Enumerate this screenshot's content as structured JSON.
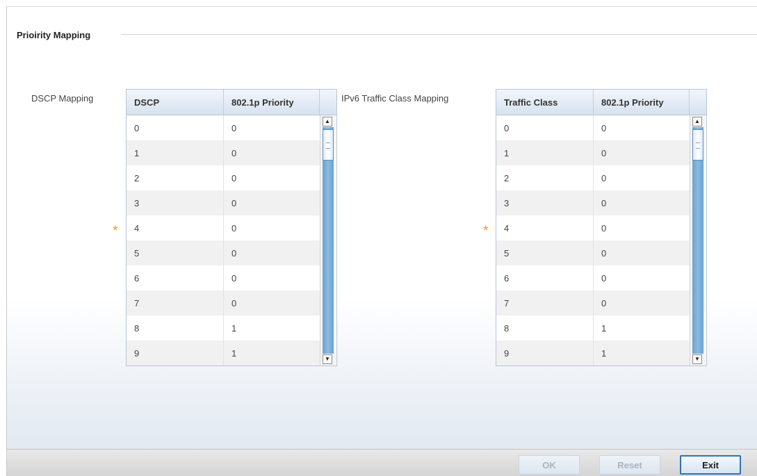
{
  "section": {
    "title": "Prioirity Mapping"
  },
  "dscp": {
    "label": "DSCP Mapping",
    "columns": [
      "DSCP",
      "802.1p Priority"
    ],
    "rows": [
      [
        "0",
        "0"
      ],
      [
        "1",
        "0"
      ],
      [
        "2",
        "0"
      ],
      [
        "3",
        "0"
      ],
      [
        "4",
        "0"
      ],
      [
        "5",
        "0"
      ],
      [
        "6",
        "0"
      ],
      [
        "7",
        "0"
      ],
      [
        "8",
        "1"
      ],
      [
        "9",
        "1"
      ]
    ]
  },
  "ipv6": {
    "label": "IPv6 Traffic Class Mapping",
    "columns": [
      "Traffic Class",
      "802.1p Priority"
    ],
    "rows": [
      [
        "0",
        "0"
      ],
      [
        "1",
        "0"
      ],
      [
        "2",
        "0"
      ],
      [
        "3",
        "0"
      ],
      [
        "4",
        "0"
      ],
      [
        "5",
        "0"
      ],
      [
        "6",
        "0"
      ],
      [
        "7",
        "0"
      ],
      [
        "8",
        "1"
      ],
      [
        "9",
        "1"
      ]
    ]
  },
  "required_marker": "*",
  "footer": {
    "ok_label": "OK",
    "reset_label": "Reset",
    "exit_label": "Exit"
  },
  "colors": {
    "accent": "#2f73b8",
    "required": "#f3962a",
    "scroll_track": "#7fb2dc"
  }
}
